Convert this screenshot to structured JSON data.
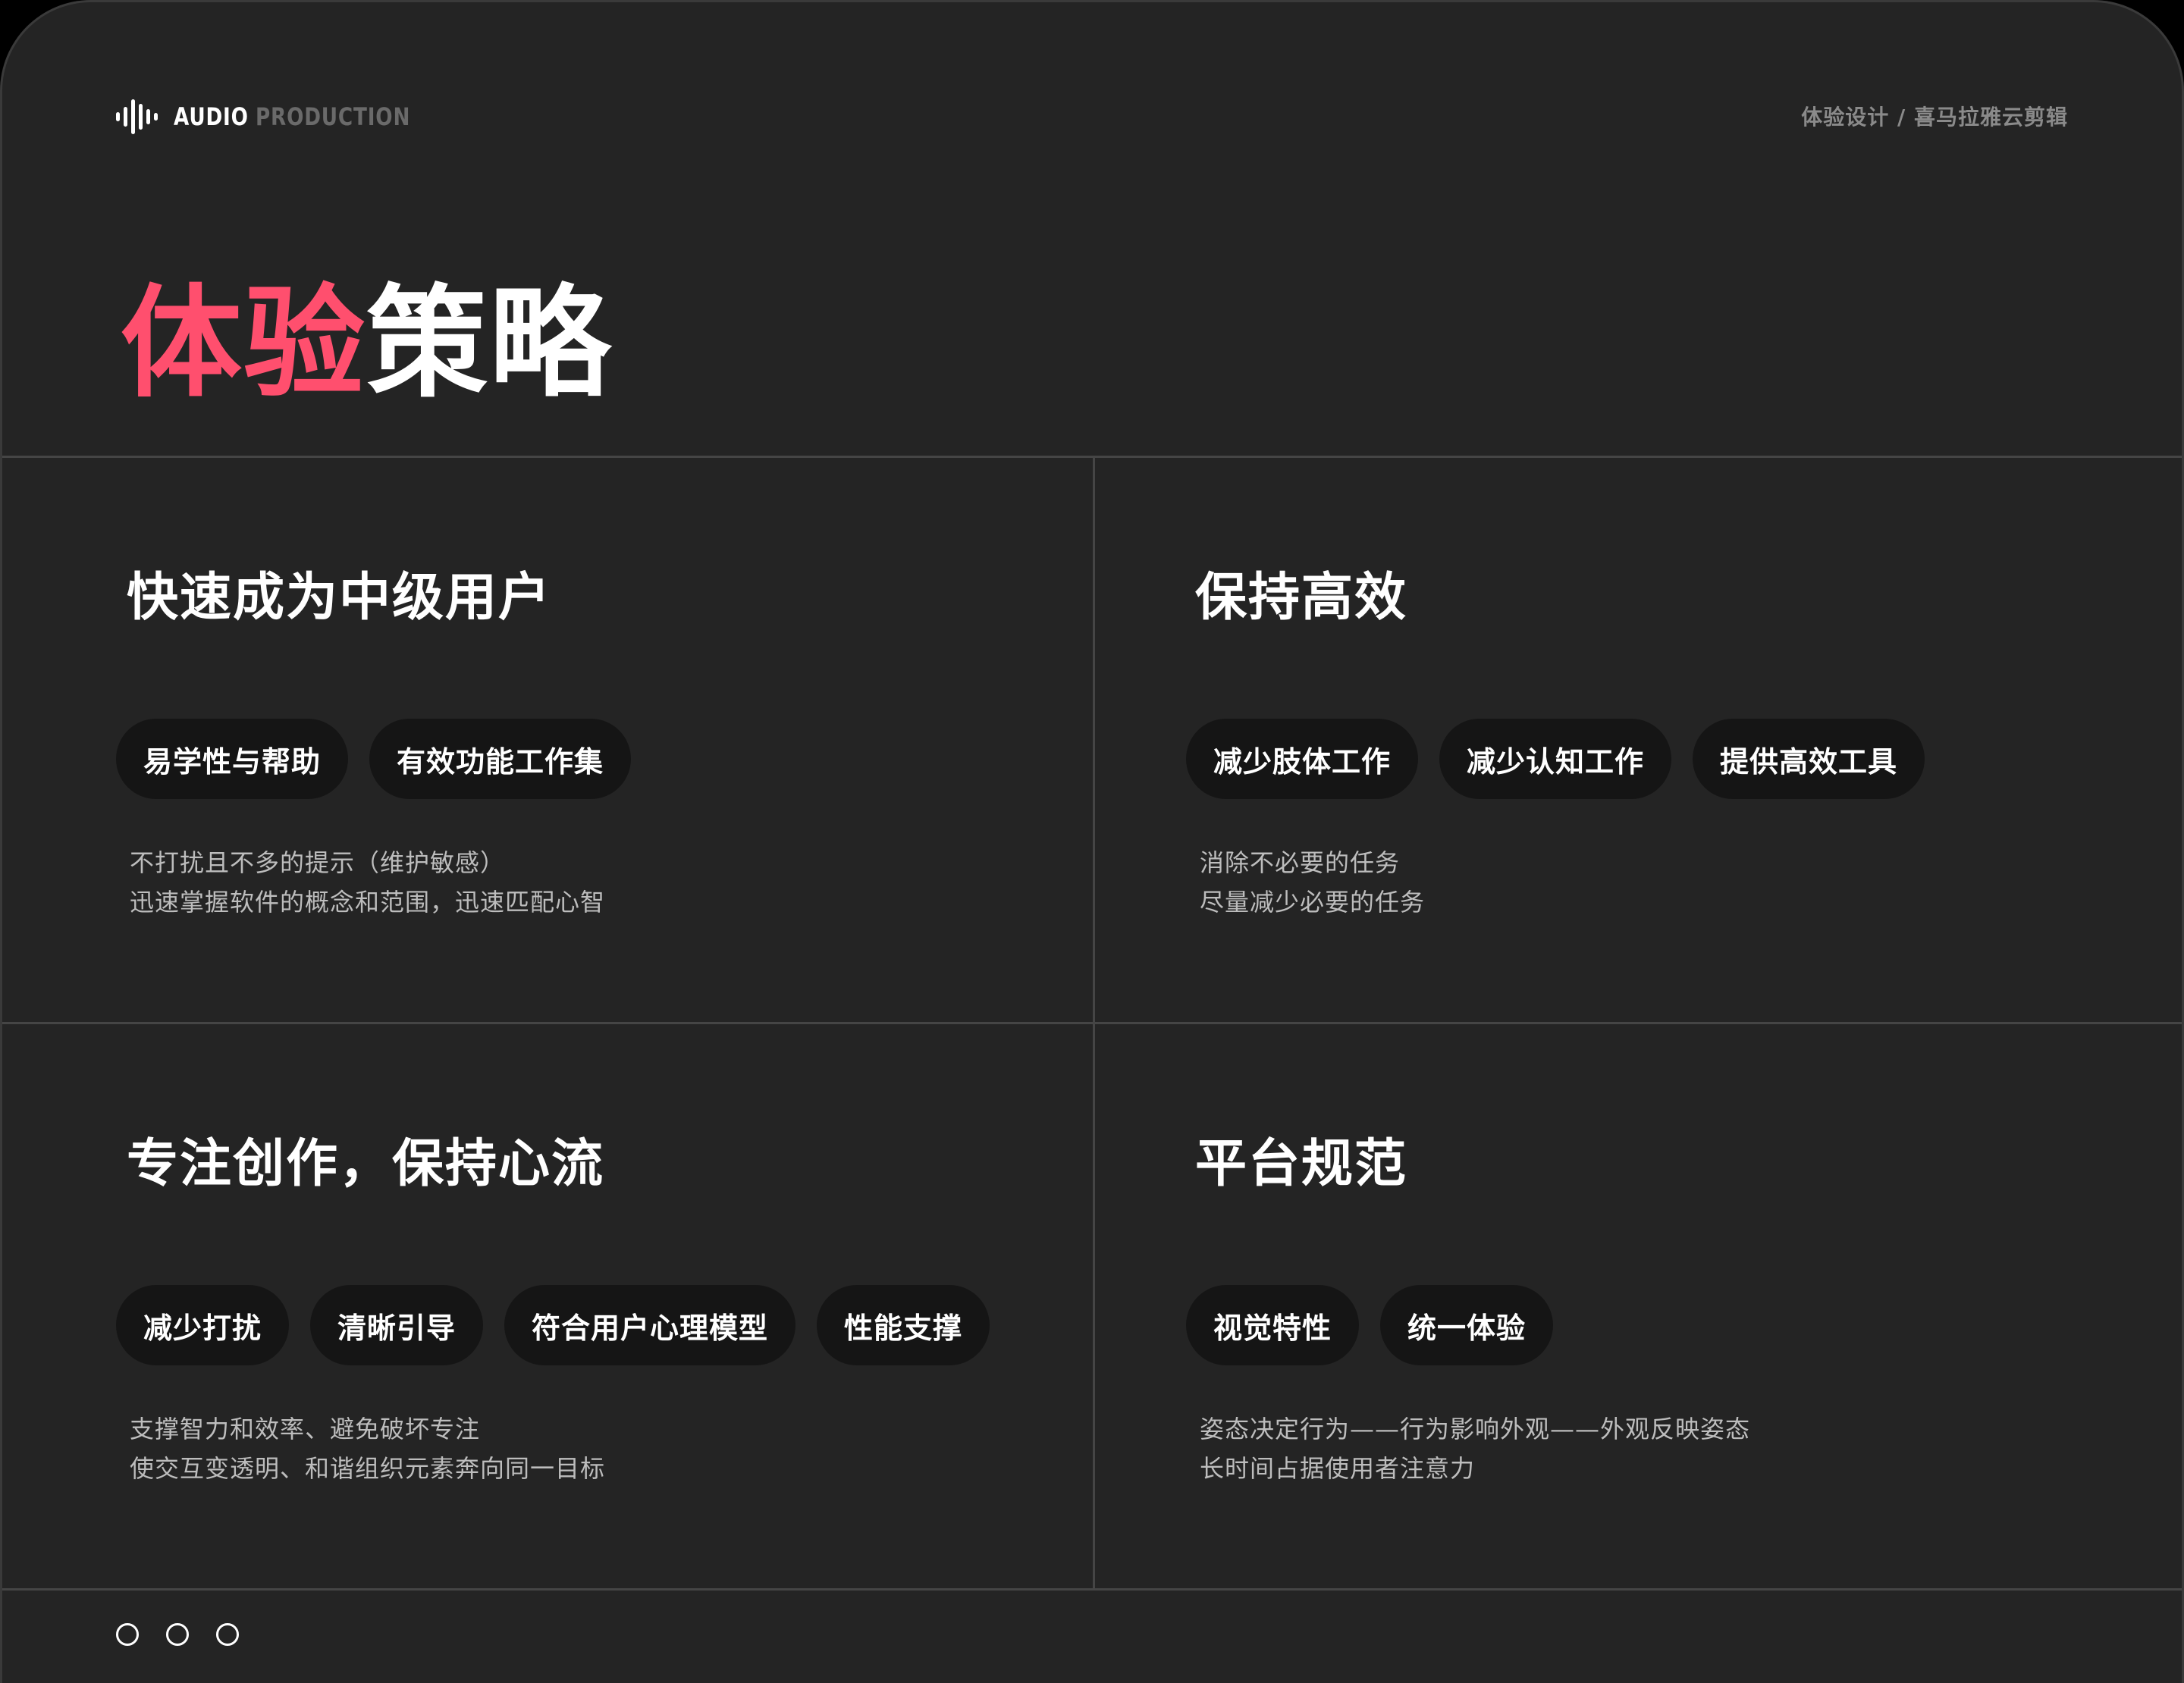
{
  "header": {
    "brand_primary": "AUDIO",
    "brand_secondary": "PRODUCTION",
    "breadcrumb": "体验设计 / 喜马拉雅云剪辑"
  },
  "title": {
    "accent": "体验",
    "rest": "策略"
  },
  "colors": {
    "accent": "#ff4f6e",
    "background": "#242424",
    "tag_background": "#151515"
  },
  "cells": [
    {
      "title": "快速成为中级用户",
      "tags": [
        "易学性与帮助",
        "有效功能工作集"
      ],
      "lines": [
        "不打扰且不多的提示（维护敏感）",
        "迅速掌握软件的概念和范围，迅速匹配心智"
      ]
    },
    {
      "title": "保持高效",
      "tags": [
        "减少肢体工作",
        "减少认知工作",
        "提供高效工具"
      ],
      "lines": [
        "消除不必要的任务",
        "尽量减少必要的任务"
      ]
    },
    {
      "title": "专注创作，保持心流",
      "tags": [
        "减少打扰",
        "清晰引导",
        "符合用户心理模型",
        "性能支撑"
      ],
      "lines": [
        "支撑智力和效率、避免破坏专注",
        "使交互变透明、和谐组织元素奔向同一目标"
      ]
    },
    {
      "title": "平台规范",
      "tags": [
        "视觉特性",
        "统一体验"
      ],
      "lines": [
        "姿态决定行为——行为影响外观——外观反映姿态",
        "长时间占据使用者注意力"
      ]
    }
  ],
  "pagination": {
    "icons": [
      "circle-icon",
      "circle-icon",
      "circle-icon"
    ]
  }
}
